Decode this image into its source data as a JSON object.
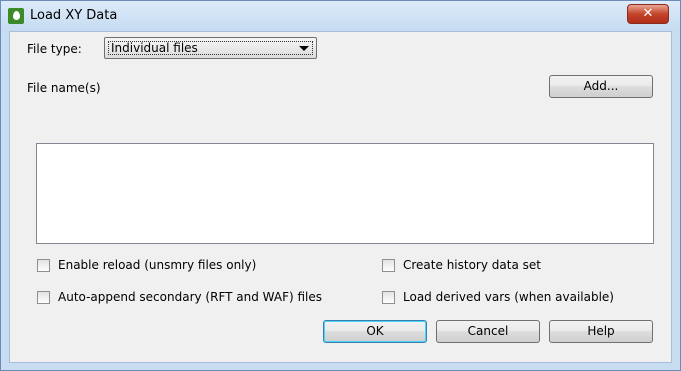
{
  "window": {
    "title": "Load XY Data",
    "close_label": "✕"
  },
  "file_type": {
    "label": "File type:",
    "value": "Individual files"
  },
  "file_names": {
    "label": "File name(s)",
    "add_label": "Add...",
    "items": []
  },
  "options": {
    "enable_reload": {
      "label": "Enable reload (unsmry files only)",
      "checked": false
    },
    "auto_append": {
      "label": "Auto-append secondary (RFT and WAF) files",
      "checked": false
    },
    "create_history": {
      "label": "Create history data set",
      "checked": false
    },
    "load_derived": {
      "label": "Load derived vars (when available)",
      "checked": false
    }
  },
  "buttons": {
    "ok": "OK",
    "cancel": "Cancel",
    "help": "Help"
  },
  "colors": {
    "title_bar": "#c6dbf1",
    "close_button": "#c4432b",
    "app_icon": "#3c8a2a"
  },
  "icons": {
    "app": "water-drop-icon",
    "close": "close-icon",
    "dropdown": "chevron-down-icon"
  }
}
